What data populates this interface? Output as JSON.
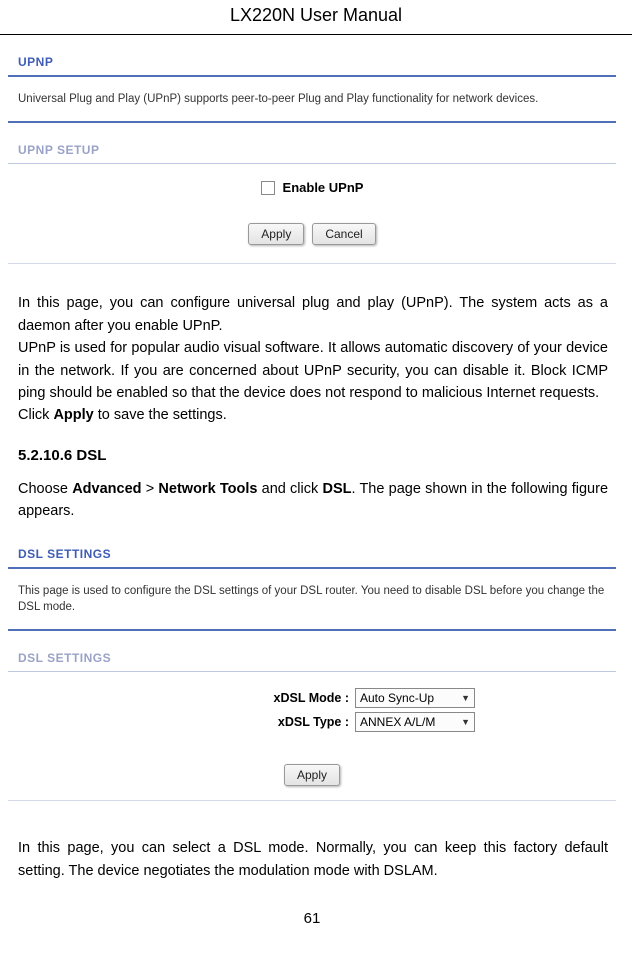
{
  "header": {
    "title": "LX220N User Manual"
  },
  "upnp": {
    "title": "UPNP",
    "desc": "Universal Plug and Play (UPnP) supports peer-to-peer Plug and Play functionality for network devices.",
    "setup_title": "UPNP SETUP",
    "enable_label": "Enable UPnP",
    "apply": "Apply",
    "cancel": "Cancel"
  },
  "body1": {
    "p1": "In this page, you can configure universal plug and play (UPnP). The system acts as a daemon after you enable UPnP.",
    "p2": "UPnP is used for popular audio visual software. It allows automatic discovery of your device in the network. If you are concerned about UPnP security, you can disable it. Block ICMP ping should be enabled so that the device does not respond to malicious Internet requests.",
    "p3a": "Click ",
    "p3b": "Apply",
    "p3c": " to save the settings."
  },
  "dsl_heading": {
    "num": "5.2.10.6",
    "title": "DSL"
  },
  "dsl_nav": {
    "a": "Choose ",
    "b": "Advanced",
    "c": " > ",
    "d": "Network Tools",
    "e": " and click ",
    "f": "DSL",
    "g": ". The page shown in the following figure appears."
  },
  "dsl": {
    "title1": "DSL SETTINGS",
    "desc": "This page is used to configure the DSL settings of your DSL router. You need to disable DSL before you change the DSL mode.",
    "title2": "DSL SETTINGS",
    "mode_label": "xDSL Mode :",
    "mode_value": "Auto Sync-Up",
    "type_label": "xDSL Type :",
    "type_value": "ANNEX A/L/M",
    "apply": "Apply"
  },
  "body2": {
    "p1": "In this page, you can select a DSL mode. Normally, you can keep this factory default setting. The device negotiates the modulation mode with DSLAM."
  },
  "pagenum": "61"
}
